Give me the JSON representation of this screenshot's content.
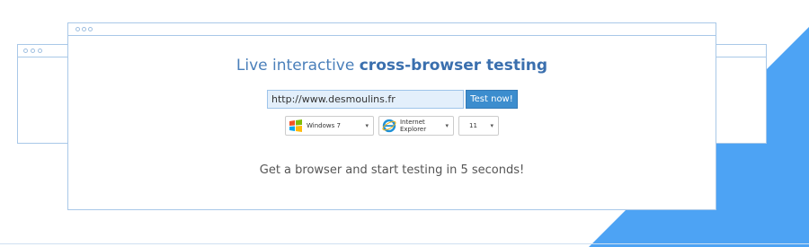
{
  "headline": {
    "prefix": "Live interactive",
    "emphasis": "cross-browser testing"
  },
  "url_input": {
    "value": "http://www.desmoulins.fr"
  },
  "test_button": {
    "label": "Test now!"
  },
  "selectors": {
    "os": {
      "value": "Windows 7",
      "icon": "windows-logo-icon"
    },
    "browser": {
      "value": "Internet Explorer",
      "icon": "internet-explorer-icon"
    },
    "version": {
      "value": "11"
    }
  },
  "tagline": "Get a browser and start testing in 5 seconds!",
  "colors": {
    "accent_triangle": "#4da3f4",
    "window_border": "#a9c8e8",
    "headline": "#4a7fba",
    "button": "#3c8dce",
    "input_bg": "#e3effb"
  }
}
